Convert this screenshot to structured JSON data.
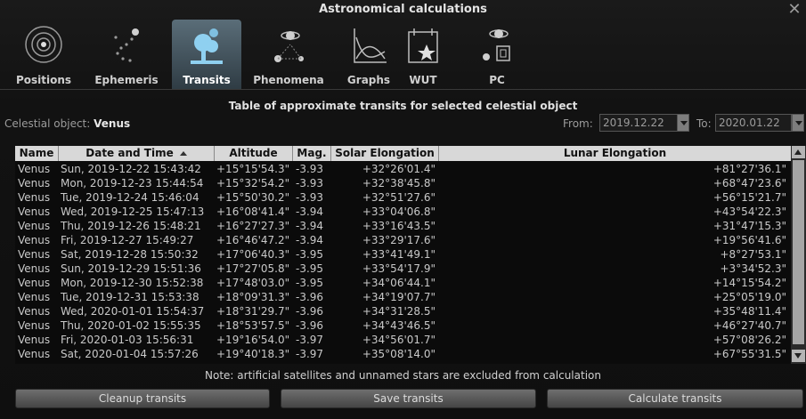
{
  "window": {
    "title": "Astronomical calculations",
    "close_glyph": "✕"
  },
  "tabs": [
    {
      "label": "Positions",
      "icon": "solar-system-icon",
      "active": false
    },
    {
      "label": "Ephemeris",
      "icon": "ephemeris-path-icon",
      "active": false
    },
    {
      "label": "Transits",
      "icon": "transits-tree-icon",
      "active": true
    },
    {
      "label": "Phenomena",
      "icon": "phenomena-icon",
      "active": false
    },
    {
      "label": "Graphs",
      "icon": "graph-icon",
      "active": false
    },
    {
      "label": "WUT",
      "icon": "wut-calendar-icon",
      "active": false
    },
    {
      "label": "PC",
      "icon": "pc-icon",
      "active": false
    }
  ],
  "heading": "Table of approximate transits for selected celestial object",
  "object": {
    "label": "Celestial object:",
    "value": "Venus"
  },
  "range": {
    "from_label": "From:",
    "from_value": "2019.12.22",
    "to_label": "To:",
    "to_value": "2020.01.22"
  },
  "table": {
    "columns": [
      "Name",
      "Date and Time",
      "Altitude",
      "Mag.",
      "Solar Elongation",
      "Lunar Elongation"
    ],
    "rows": [
      [
        "Venus",
        "Sun, 2019-12-22 15:43:42",
        "+15°15'54.3\"",
        "-3.93",
        "+32°26'01.4\"",
        "+81°27'36.1\""
      ],
      [
        "Venus",
        "Mon, 2019-12-23 15:44:54",
        "+15°32'54.2\"",
        "-3.93",
        "+32°38'45.8\"",
        "+68°47'23.6\""
      ],
      [
        "Venus",
        "Tue, 2019-12-24 15:46:04",
        "+15°50'30.2\"",
        "-3.93",
        "+32°51'27.6\"",
        "+56°15'21.7\""
      ],
      [
        "Venus",
        "Wed, 2019-12-25 15:47:13",
        "+16°08'41.4\"",
        "-3.94",
        "+33°04'06.8\"",
        "+43°54'22.3\""
      ],
      [
        "Venus",
        "Thu, 2019-12-26 15:48:21",
        "+16°27'27.3\"",
        "-3.94",
        "+33°16'43.5\"",
        "+31°47'15.3\""
      ],
      [
        "Venus",
        "Fri, 2019-12-27 15:49:27",
        "+16°46'47.2\"",
        "-3.94",
        "+33°29'17.6\"",
        "+19°56'41.6\""
      ],
      [
        "Venus",
        "Sat, 2019-12-28 15:50:32",
        "+17°06'40.3\"",
        "-3.95",
        "+33°41'49.1\"",
        "+8°27'53.1\""
      ],
      [
        "Venus",
        "Sun, 2019-12-29 15:51:36",
        "+17°27'05.8\"",
        "-3.95",
        "+33°54'17.9\"",
        "+3°34'52.3\""
      ],
      [
        "Venus",
        "Mon, 2019-12-30 15:52:38",
        "+17°48'03.0\"",
        "-3.95",
        "+34°06'44.1\"",
        "+14°15'54.2\""
      ],
      [
        "Venus",
        "Tue, 2019-12-31 15:53:38",
        "+18°09'31.3\"",
        "-3.96",
        "+34°19'07.7\"",
        "+25°05'19.0\""
      ],
      [
        "Venus",
        "Wed, 2020-01-01 15:54:37",
        "+18°31'29.7\"",
        "-3.96",
        "+34°31'28.5\"",
        "+35°48'11.4\""
      ],
      [
        "Venus",
        "Thu, 2020-01-02 15:55:35",
        "+18°53'57.5\"",
        "-3.96",
        "+34°43'46.5\"",
        "+46°27'40.7\""
      ],
      [
        "Venus",
        "Fri, 2020-01-03 15:56:31",
        "+19°16'54.0\"",
        "-3.97",
        "+34°56'01.7\"",
        "+57°08'26.2\""
      ],
      [
        "Venus",
        "Sat, 2020-01-04 15:57:26",
        "+19°40'18.3\"",
        "-3.97",
        "+35°08'14.0\"",
        "+67°55'31.5\""
      ]
    ]
  },
  "note": "Note: artificial satellites and unnamed stars are excluded from calculation",
  "buttons": {
    "cleanup": "Cleanup transits",
    "save": "Save transits",
    "calculate": "Calculate transits"
  }
}
